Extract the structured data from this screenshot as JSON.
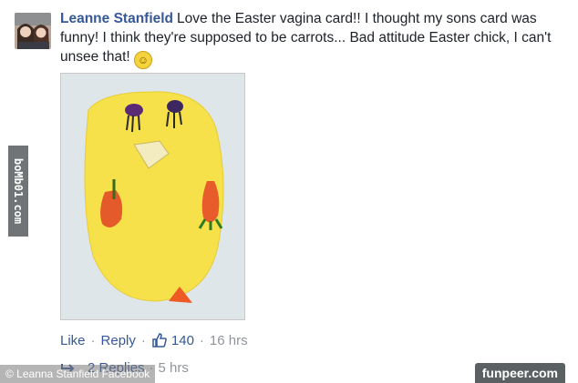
{
  "comment": {
    "author": "Leanne Stanfield",
    "text": "Love the Easter vagina card!! I thought my sons card was funny! I think they're supposed to be carrots... Bad attitude Easter chick, I can't unsee that!",
    "emoji_icon": "laughing-emoji-icon"
  },
  "actions": {
    "like": "Like",
    "dot1": "·",
    "reply": "Reply",
    "dot2": "·",
    "like_count": "140",
    "dot3": "·",
    "time": "16 hrs"
  },
  "replies": {
    "label": "2 Replies",
    "dot": "·",
    "time": "5 hrs"
  },
  "watermarks": {
    "side": "boMb01.com",
    "credit": "© Leanna Stanfield Facebook",
    "brand": "funpeer.com"
  },
  "colors": {
    "link": "#365899",
    "meta": "#90949c",
    "card_yellow": "#f7e14a"
  }
}
